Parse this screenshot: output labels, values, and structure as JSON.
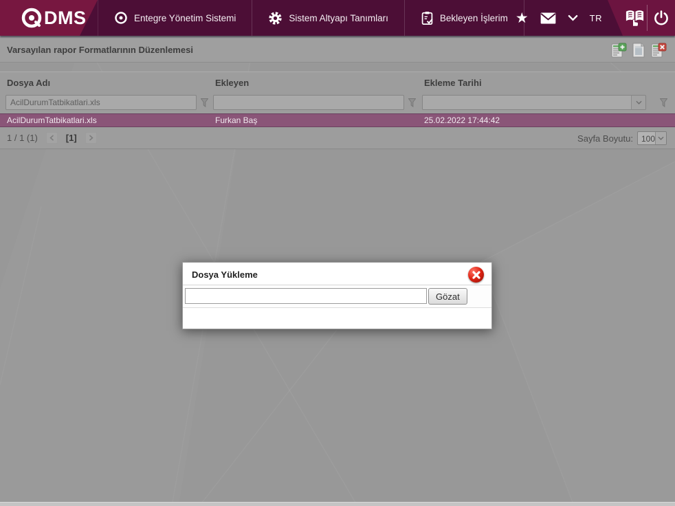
{
  "header": {
    "logo_text": "DMS",
    "menu_items": [
      {
        "label": "Entegre Yönetim Sistemi",
        "icon": "qdms-circle-icon"
      },
      {
        "label": "Sistem Altyapı Tanımları",
        "icon": "gear-icon"
      },
      {
        "label": "Bekleyen İşlerim",
        "icon": "clipboard-check-icon"
      }
    ],
    "star_glyph": "★",
    "language": "TR",
    "icons": [
      "star-icon",
      "mail-icon",
      "chevron-down-icon",
      "help-book-icon",
      "power-icon"
    ]
  },
  "toolbar": {
    "title": "Varsayılan rapor Formatlarının Düzenlemesi",
    "icons": [
      "add-report-icon",
      "document-icon",
      "delete-report-icon"
    ]
  },
  "grid": {
    "columns": [
      {
        "label": "Dosya Adı",
        "filter_value": "AcilDurumTatbikatlari.xls",
        "filter_type": "text"
      },
      {
        "label": "Ekleyen",
        "filter_value": "",
        "filter_type": "text"
      },
      {
        "label": "Ekleme Tarihi",
        "filter_value": "",
        "filter_type": "dropdown"
      }
    ],
    "rows": [
      {
        "dosya_adi": "AcilDurumTatbikatlari.xls",
        "ekleyen": "Furkan Baş",
        "ekleme_tarihi": "25.02.2022 17:44:42"
      }
    ],
    "pagination": {
      "summary": "1 / 1 (1)",
      "current_page": "[1]",
      "page_size_label": "Sayfa Boyutu:",
      "page_size": "100"
    }
  },
  "modal": {
    "title": "Dosya Yükleme",
    "file_input_value": "",
    "browse_button": "Gözat"
  },
  "colors": {
    "topbar_bg": "#4c0e36",
    "brand_maroon": "#771740",
    "selected_row": "#8a5578",
    "close_red": "#df2414",
    "page_bg": "#989898"
  }
}
